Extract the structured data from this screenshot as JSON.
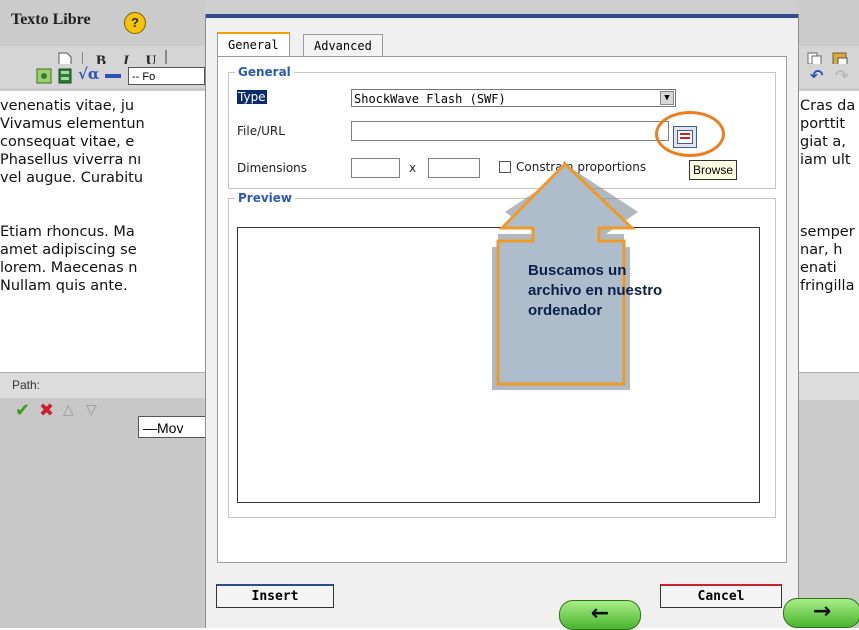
{
  "editor": {
    "section_title": "Texto Libre",
    "help_label": "?",
    "toolbar_left": [
      "B",
      "I",
      "U"
    ],
    "font_select_partial": "-- Fo",
    "text_left": [
      "venenatis vitae, ju",
      "Vivamus elementun",
      "consequat vitae, e",
      "Phasellus viverra nı",
      "vel augue. Curabitu",
      "",
      "",
      "Etiam rhoncus. Ma",
      "amet adipiscing se",
      "lorem. Maecenas n",
      "Nullam quis ante."
    ],
    "text_right": [
      "Cras da",
      "porttit",
      "giat a,",
      "iam ult",
      "",
      "",
      "",
      "semper",
      "nar, h",
      "enati",
      "fringilla"
    ],
    "path_label": "Path:",
    "move_select_partial": "—Mov"
  },
  "dialog": {
    "tabs": [
      {
        "label": "General",
        "active": true
      },
      {
        "label": "Advanced",
        "active": false
      }
    ],
    "general_legend": "General",
    "type_label": "Type",
    "type_value": "ShockWave Flash (SWF)",
    "file_label": "File/URL",
    "file_value": "",
    "dimensions_label": "Dimensions",
    "dim_separator": "x",
    "constrain_label": "Constrain proportions",
    "constrain_checked": false,
    "browse_tooltip": "Browse",
    "preview_legend": "Preview",
    "insert_label": "Insert",
    "cancel_label": "Cancel"
  },
  "callout": {
    "text": "Buscamos un\narchivo en nuestro\nordenador"
  },
  "nav": {
    "back_label": "←",
    "next_label": "→"
  },
  "colors": {
    "highlight_ring": "#f07c1c",
    "callout_fill": "#aebdcb",
    "callout_border": "#ee9a28",
    "nav_green": "#6fd44a"
  }
}
